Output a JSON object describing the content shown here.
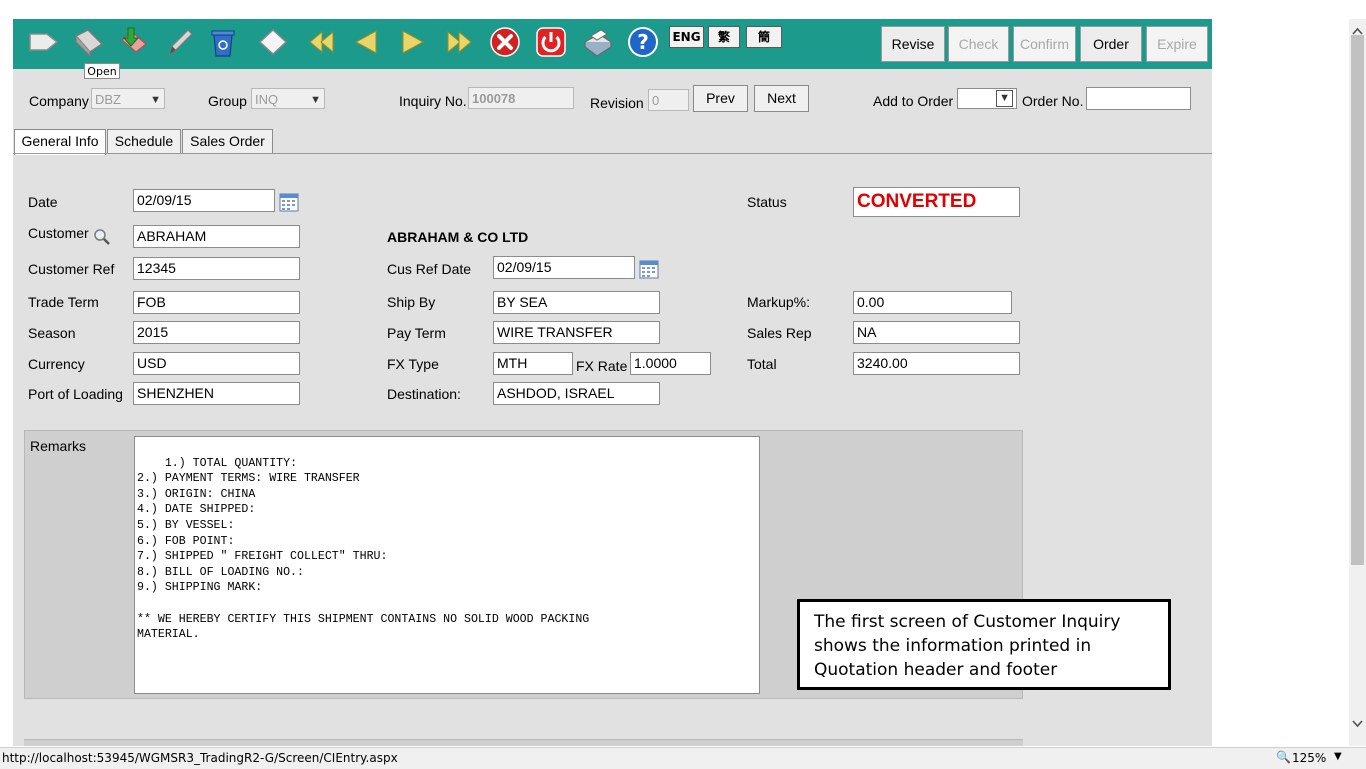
{
  "toolbar": {
    "icons": [
      "new-icon",
      "open-icon",
      "download-icon",
      "pencil-icon",
      "recycle-bin-icon",
      "clear-icon",
      "first-icon",
      "prev-icon",
      "next-icon",
      "last-icon",
      "cancel-icon",
      "power-icon",
      "print-icon",
      "help-icon"
    ],
    "tooltip": "Open",
    "lang": [
      "ENG",
      "繁",
      "簡"
    ],
    "actions": [
      {
        "label": "Revise",
        "enabled": true
      },
      {
        "label": "Check",
        "enabled": false
      },
      {
        "label": "Confirm",
        "enabled": false
      },
      {
        "label": "Order",
        "enabled": true
      },
      {
        "label": "Expire",
        "enabled": false
      }
    ]
  },
  "header": {
    "company_label": "Company",
    "company_value": "DBZ",
    "group_label": "Group",
    "group_value": "INQ",
    "inquiry_label": "Inquiry No.",
    "inquiry_value": "100078",
    "revision_label": "Revision",
    "revision_value": "0",
    "prev_label": "Prev",
    "next_label": "Next",
    "add_order_label": "Add to Order",
    "add_order_value": "",
    "order_no_label": "Order No.",
    "order_no_value": ""
  },
  "tabs": [
    "General Info",
    "Schedule",
    "Sales Order"
  ],
  "form": {
    "date_label": "Date",
    "date_value": "02/09/15",
    "customer_label": "Customer",
    "customer_value": "ABRAHAM",
    "customer_name": "ABRAHAM & CO LTD",
    "customer_ref_label": "Customer Ref",
    "customer_ref_value": "12345",
    "cus_ref_date_label": "Cus Ref Date",
    "cus_ref_date_value": "02/09/15",
    "trade_term_label": "Trade Term",
    "trade_term_value": "FOB",
    "ship_by_label": "Ship By",
    "ship_by_value": "BY SEA",
    "markup_label": "Markup%:",
    "markup_value": "0.00",
    "season_label": "Season",
    "season_value": "2015",
    "pay_term_label": "Pay Term",
    "pay_term_value": "WIRE TRANSFER",
    "sales_rep_label": "Sales Rep",
    "sales_rep_value": "NA",
    "currency_label": "Currency",
    "currency_value": "USD",
    "fx_type_label": "FX Type",
    "fx_type_value": "MTH",
    "fx_rate_label": "FX Rate",
    "fx_rate_value": "1.0000",
    "total_label": "Total",
    "total_value": "3240.00",
    "port_label": "Port of Loading",
    "port_value": "SHENZHEN",
    "destination_label": "Destination:",
    "destination_value": "ASHDOD, ISRAEL",
    "status_label": "Status",
    "status_value": "CONVERTED"
  },
  "remarks": {
    "label": "Remarks",
    "text": "1.) TOTAL QUANTITY:\n2.) PAYMENT TERMS: WIRE TRANSFER\n3.) ORIGIN: CHINA\n4.) DATE SHIPPED:\n5.) BY VESSEL:\n6.) FOB POINT:\n7.) SHIPPED \" FREIGHT COLLECT\" THRU:\n8.) BILL OF LOADING NO.:\n9.) SHIPPING MARK:\n\n** WE HEREBY CERTIFY THIS SHIPMENT CONTAINS NO SOLID WOOD PACKING\nMATERIAL."
  },
  "callout": "The first screen of Customer Inquiry shows the information printed in Quotation header and footer",
  "statusbar": {
    "url": "http://localhost:53945/WGMSR3_TradingR2-G/Screen/CIEntry.aspx",
    "zoom": "125%"
  },
  "colors": {
    "teal": "#1c9a8b",
    "status_red": "#e00000",
    "panel_gray": "#e1e1e1"
  }
}
